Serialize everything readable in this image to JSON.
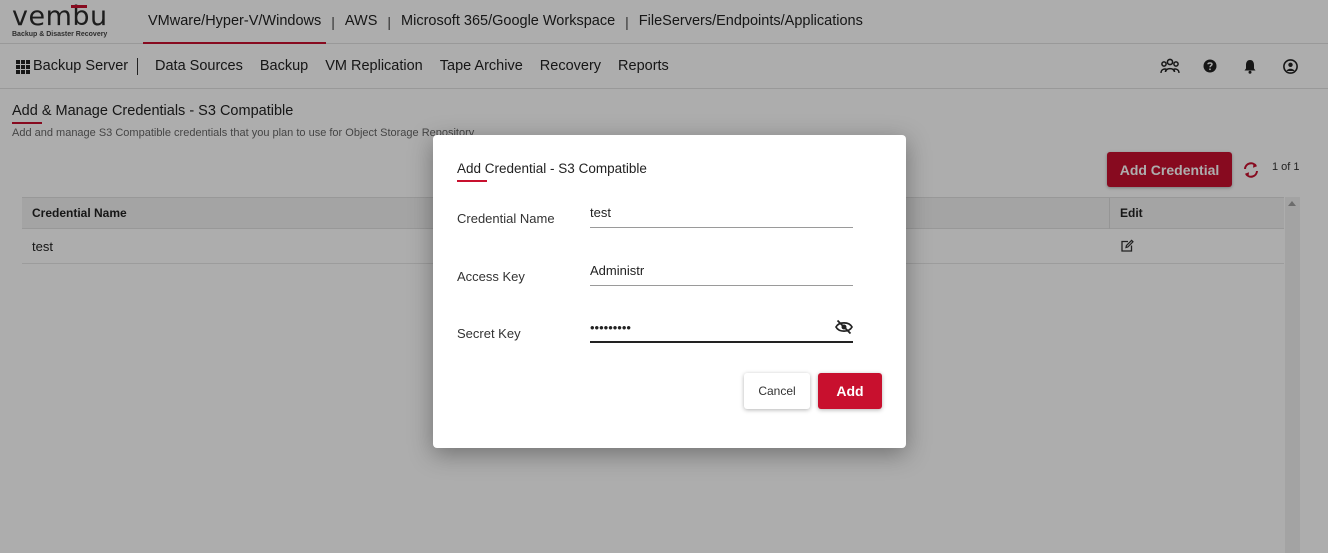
{
  "brand": {
    "logo_text": "vembu",
    "tagline": "Backup & Disaster Recovery",
    "accent_color": "#c8102e"
  },
  "product_tabs": [
    {
      "label": "VMware/Hyper-V/Windows",
      "active": true
    },
    {
      "label": "AWS",
      "active": false
    },
    {
      "label": "Microsoft 365/Google Workspace",
      "active": false
    },
    {
      "label": "FileServers/Endpoints/Applications",
      "active": false
    }
  ],
  "product_separator": "|",
  "nav": {
    "apps_icon": "apps-grid-icon",
    "server_label": "Backup Server",
    "items": [
      "Data Sources",
      "Backup",
      "VM Replication",
      "Tape Archive",
      "Recovery",
      "Reports"
    ],
    "right_icons": [
      "users-group-icon",
      "help-icon",
      "bell-icon",
      "account-icon"
    ]
  },
  "page": {
    "title": "Add & Manage Credentials - S3 Compatible",
    "subtitle": "Add and manage S3 Compatible credentials that you plan to use for Object Storage Repository",
    "add_button": "Add Credential",
    "refresh_icon": "refresh-icon",
    "pager": "1 of 1"
  },
  "table": {
    "columns": [
      "Credential Name",
      "Edit"
    ],
    "rows": [
      {
        "name": "test",
        "edit_icon": "edit-icon"
      }
    ]
  },
  "dialog": {
    "title": "Add Credential - S3 Compatible",
    "fields": {
      "credential_name": {
        "label": "Credential Name",
        "value": "test"
      },
      "access_key": {
        "label": "Access Key",
        "value": "Administr"
      },
      "secret_key": {
        "label": "Secret Key",
        "value": "•••••••••",
        "visibility_icon": "eye-slash-icon"
      }
    },
    "cancel_label": "Cancel",
    "add_label": "Add"
  }
}
